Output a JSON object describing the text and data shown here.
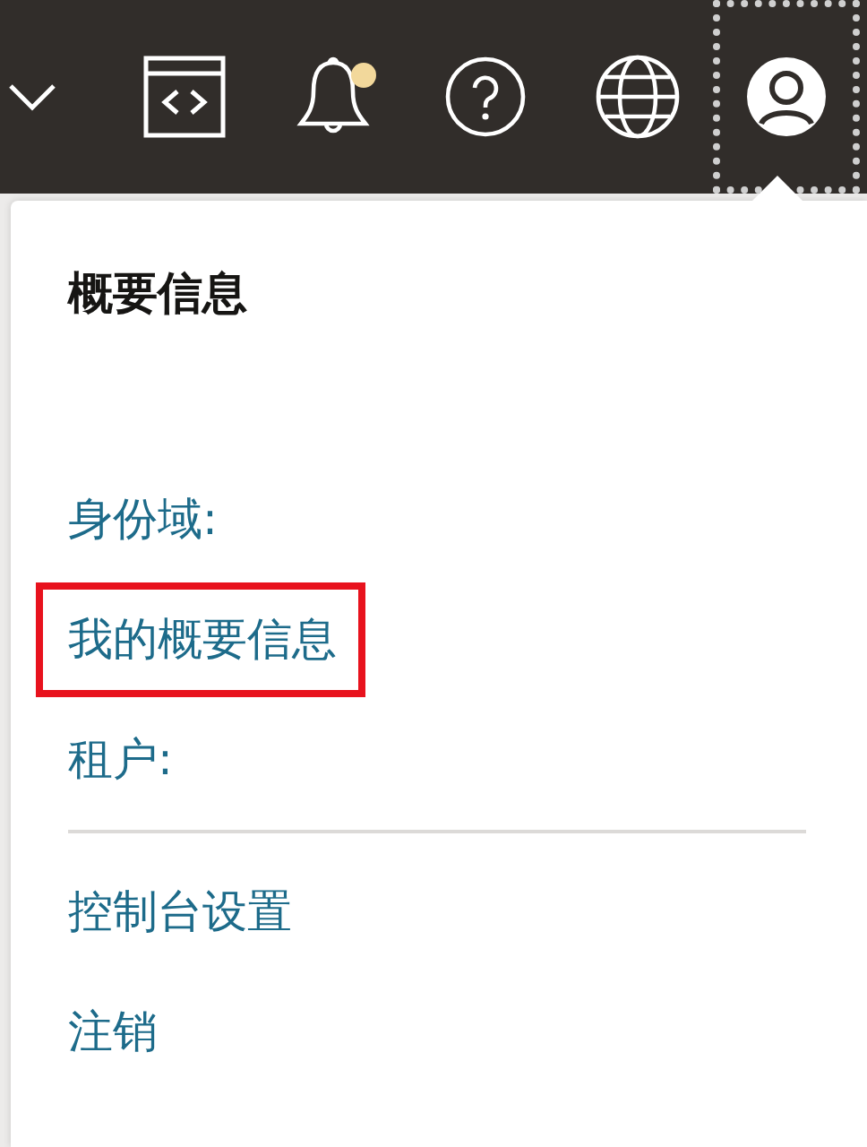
{
  "toolbar": {
    "has_notification": true,
    "profile_focused": true
  },
  "profile_menu": {
    "title": "概要信息",
    "items": [
      {
        "label": "身份域:",
        "highlighted": false,
        "divider_before": false
      },
      {
        "label": "我的概要信息",
        "highlighted": true,
        "divider_before": false
      },
      {
        "label": "租户:",
        "highlighted": false,
        "divider_before": false
      },
      {
        "label": "控制台设置",
        "highlighted": false,
        "divider_before": true
      },
      {
        "label": "注销",
        "highlighted": false,
        "divider_before": false
      }
    ]
  }
}
